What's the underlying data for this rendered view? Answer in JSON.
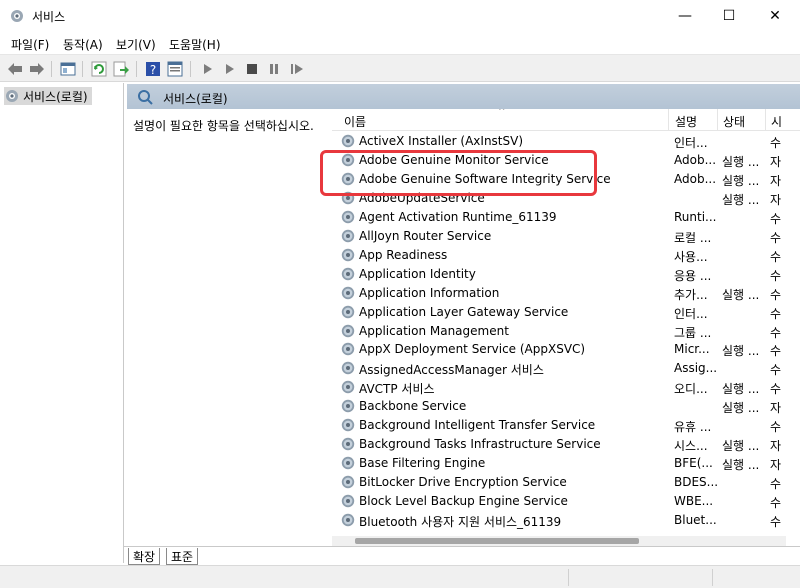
{
  "window": {
    "title": "서비스",
    "minimize": "—",
    "maximize": "☐",
    "close": "✕"
  },
  "menu": [
    {
      "label": "파일(F)"
    },
    {
      "label": "동작(A)"
    },
    {
      "label": "보기(V)"
    },
    {
      "label": "도움말(H)"
    }
  ],
  "toolbar": {
    "icons": [
      "back-arrow-icon",
      "forward-arrow-icon",
      "console-tree-icon",
      "refresh-icon",
      "export-icon",
      "help-icon",
      "properties-icon",
      "start-icon",
      "start-alt-icon",
      "stop-icon",
      "pause-icon",
      "restart-icon"
    ]
  },
  "tree": {
    "root_label": "서비스(로컬)"
  },
  "content": {
    "header_title": "서비스(로컬)",
    "description_prompt": "설명이 필요한 항목을 선택하십시오."
  },
  "columns": {
    "name": "이름",
    "description": "설명",
    "status": "상태",
    "startup": "시"
  },
  "services": [
    {
      "name": "ActiveX Installer (AxInstSV)",
      "desc": "인터...",
      "status": "",
      "startup": "수"
    },
    {
      "name": "Adobe Genuine Monitor Service",
      "desc": "Adob...",
      "status": "실행 ...",
      "startup": "자"
    },
    {
      "name": "Adobe Genuine Software Integrity Service",
      "desc": "Adob...",
      "status": "실행 ...",
      "startup": "자"
    },
    {
      "name": "AdobeUpdateService",
      "desc": "",
      "status": "실행 ...",
      "startup": "자"
    },
    {
      "name": "Agent Activation Runtime_61139",
      "desc": "Runti...",
      "status": "",
      "startup": "수"
    },
    {
      "name": "AllJoyn Router Service",
      "desc": "로컬 ...",
      "status": "",
      "startup": "수"
    },
    {
      "name": "App Readiness",
      "desc": "사용...",
      "status": "",
      "startup": "수"
    },
    {
      "name": "Application Identity",
      "desc": "응용 ...",
      "status": "",
      "startup": "수"
    },
    {
      "name": "Application Information",
      "desc": "추가...",
      "status": "실행 ...",
      "startup": "수"
    },
    {
      "name": "Application Layer Gateway Service",
      "desc": "인터...",
      "status": "",
      "startup": "수"
    },
    {
      "name": "Application Management",
      "desc": "그룹 ...",
      "status": "",
      "startup": "수"
    },
    {
      "name": "AppX Deployment Service (AppXSVC)",
      "desc": "Micr...",
      "status": "실행 ...",
      "startup": "수"
    },
    {
      "name": "AssignedAccessManager 서비스",
      "desc": "Assig...",
      "status": "",
      "startup": "수"
    },
    {
      "name": "AVCTP 서비스",
      "desc": "오디...",
      "status": "실행 ...",
      "startup": "수"
    },
    {
      "name": "Backbone Service",
      "desc": "",
      "status": "실행 ...",
      "startup": "자"
    },
    {
      "name": "Background Intelligent Transfer Service",
      "desc": "유휴 ...",
      "status": "",
      "startup": "수"
    },
    {
      "name": "Background Tasks Infrastructure Service",
      "desc": "시스...",
      "status": "실행 ...",
      "startup": "자"
    },
    {
      "name": "Base Filtering Engine",
      "desc": "BFE(...",
      "status": "실행 ...",
      "startup": "자"
    },
    {
      "name": "BitLocker Drive Encryption Service",
      "desc": "BDES...",
      "status": "",
      "startup": "수"
    },
    {
      "name": "Block Level Backup Engine Service",
      "desc": "WBE...",
      "status": "",
      "startup": "수"
    },
    {
      "name": "Bluetooth 사용자 지원 서비스_61139",
      "desc": "Bluet...",
      "status": "",
      "startup": "수"
    }
  ],
  "tabs": [
    {
      "label": "확장"
    },
    {
      "label": "표준"
    }
  ],
  "colors": {
    "highlight": "#e8383d",
    "header_band": "#b8c8d8"
  }
}
